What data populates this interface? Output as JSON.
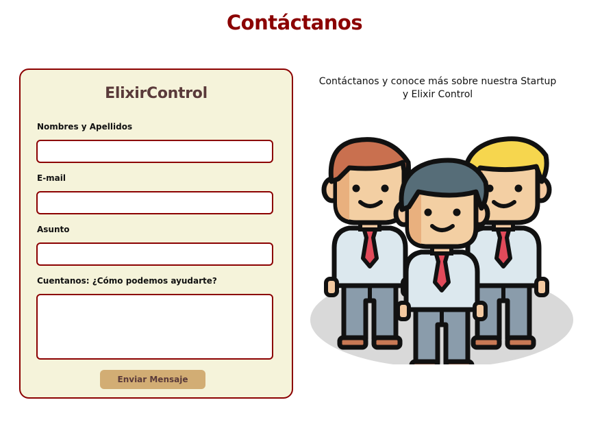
{
  "page": {
    "title": "Contáctanos"
  },
  "form": {
    "brand": "ElixirControl",
    "fields": [
      {
        "label": "Nombres y Apellidos",
        "value": "",
        "placeholder": ""
      },
      {
        "label": "E-mail",
        "value": "",
        "placeholder": ""
      },
      {
        "label": "Asunto",
        "value": "",
        "placeholder": ""
      },
      {
        "label": "Cuentanos:  ¿Cómo podemos ayudarte?",
        "value": "",
        "placeholder": ""
      }
    ],
    "submit_label": "Enviar Mensaje"
  },
  "side": {
    "intro_line1": "Contáctanos y conoce más sobre nuestra Startup",
    "intro_line2": "y Elixir Control",
    "illustration_icon": "team-of-three-businessmen-icon"
  },
  "colors": {
    "title": "#8b0000",
    "card_background": "#f5f3da",
    "card_border": "#8b0000",
    "button": "#d2ad74",
    "brand_text": "#5a3a3a"
  }
}
